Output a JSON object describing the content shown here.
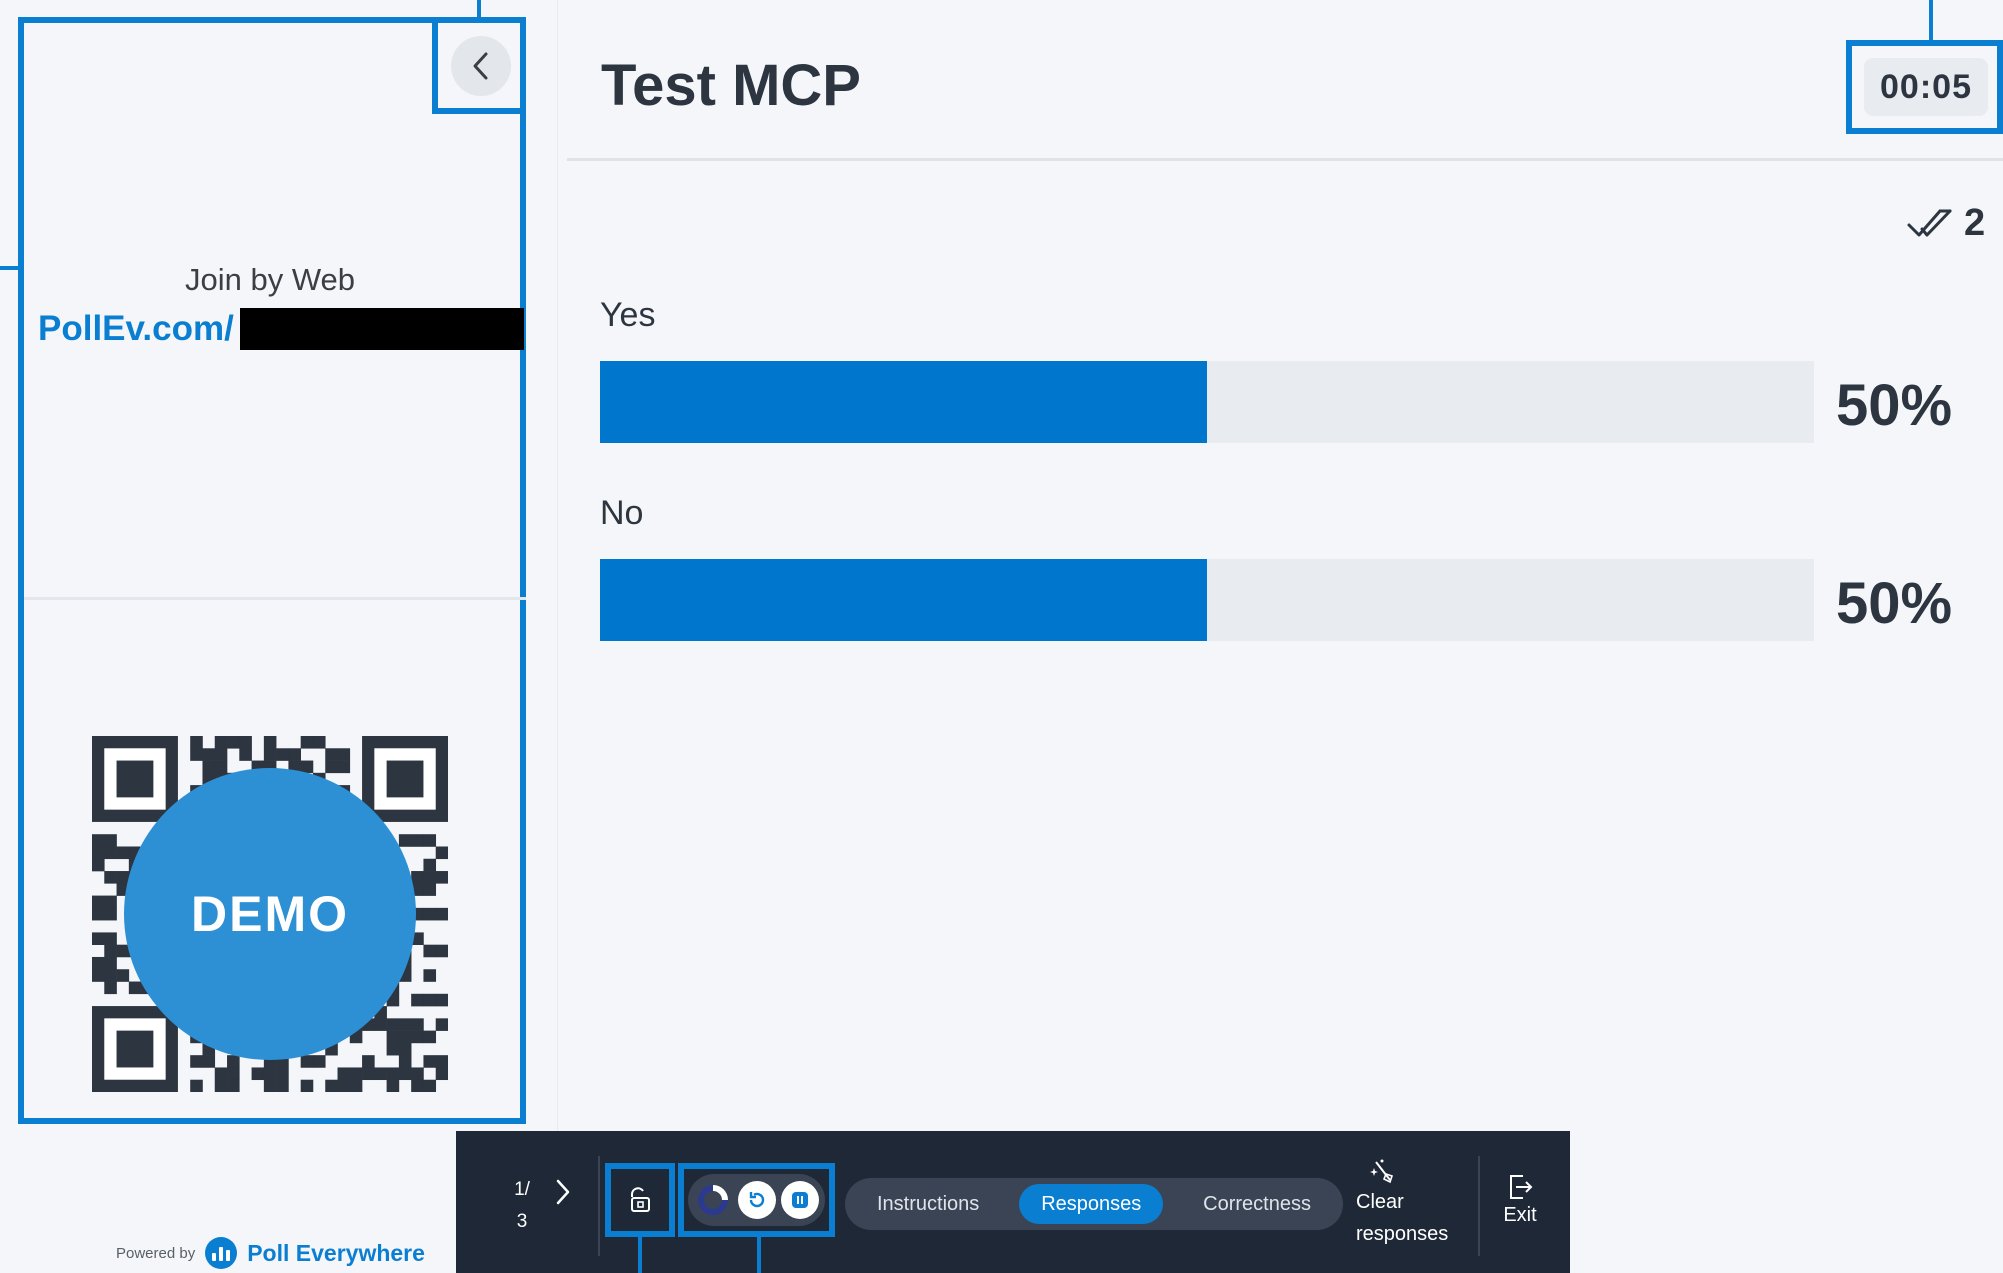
{
  "left_panel": {
    "join_label": "Join by Web",
    "join_url": "PollEv.com/",
    "demo_label": "DEMO",
    "powered_by": "Powered by",
    "brand_name": "Poll Everywhere"
  },
  "main": {
    "title": "Test MCP",
    "timer": "00:05",
    "response_count": "2",
    "options": [
      {
        "label": "Yes",
        "percent": 50,
        "percent_label": "50%"
      },
      {
        "label": "No",
        "percent": 50,
        "percent_label": "50%"
      }
    ]
  },
  "toolbar": {
    "slide_current": "1/",
    "slide_total": "3",
    "tabs": [
      {
        "label": "Instructions",
        "active": false
      },
      {
        "label": "Responses",
        "active": true
      },
      {
        "label": "Correctness",
        "active": false
      }
    ],
    "clear_line1": "Clear",
    "clear_line2": "responses",
    "exit_label": "Exit"
  },
  "colors": {
    "accent": "#0a7ed0",
    "bar": "#0077cc",
    "toolbar_bg": "#1f2837",
    "background": "#f4f6f9"
  },
  "icons": [
    "chevron-left-icon",
    "double-check-icon",
    "chevron-right-icon",
    "lock-icon",
    "visibility-ring-icon",
    "reset-icon",
    "pause-icon",
    "broom-sparkle-icon",
    "exit-icon",
    "poll-everywhere-logo-icon"
  ]
}
